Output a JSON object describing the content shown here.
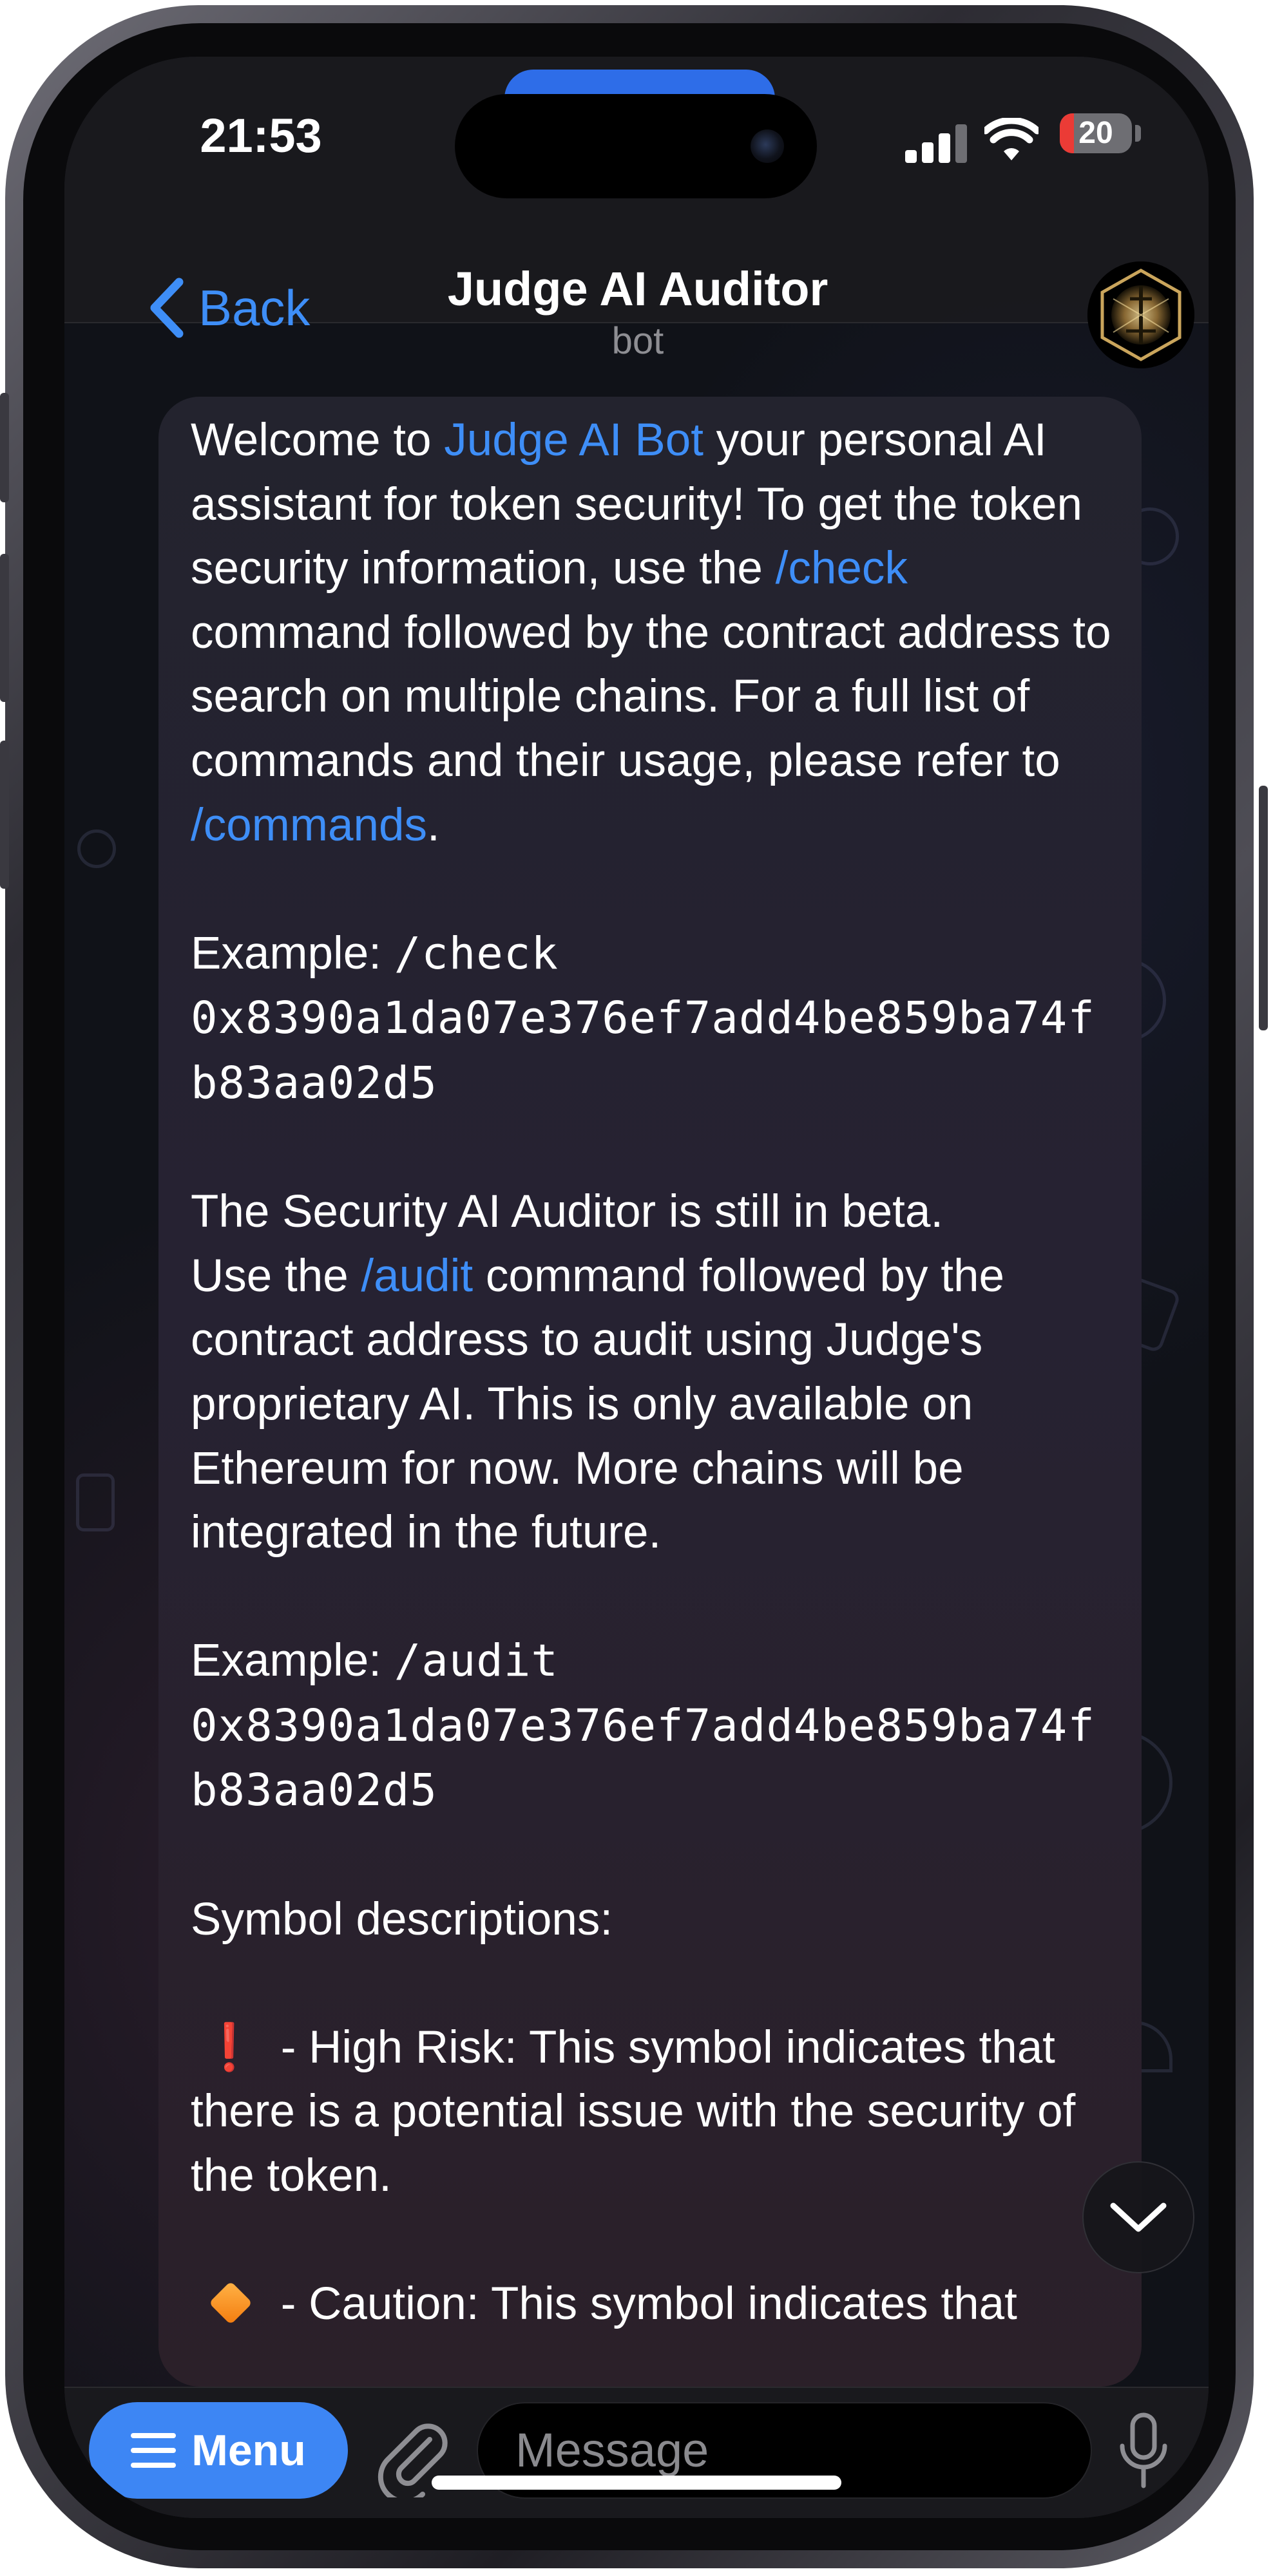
{
  "status_bar": {
    "time": "21:53",
    "battery_level": "20",
    "battery_fraction": 0.2,
    "live_activity_color": "#2e6de8"
  },
  "header": {
    "back_label": "Back",
    "title": "Judge AI Auditor",
    "subtitle": "bot",
    "avatar_icon": "judge-logo"
  },
  "message": {
    "welcome_pre": "Welcome to ",
    "welcome_link": "Judge AI Bot",
    "welcome_mid1": " your personal AI assistant for token security! To get the token security information, use the ",
    "check_link": "/check",
    "welcome_mid2": " command followed by the contract address to search on multiple chains. For a full list of commands and their usage, please refer to ",
    "commands_link": "/commands",
    "welcome_end": ".",
    "example_label": "Example: ",
    "check_example_cmd": "/check",
    "check_example_addr": "0x8390a1da07e376ef7add4be859ba74fb83aa02d5",
    "beta_line": "The Security AI Auditor is still in beta.",
    "audit_pre": "Use the ",
    "audit_link": "/audit",
    "audit_post": " command followed by the contract address to audit using Judge's proprietary AI. This is only available on Ethereum for now. More chains will be integrated in the future.",
    "audit_example_cmd": "/audit",
    "audit_example_addr": "0x8390a1da07e376ef7add4be859ba74fb83aa02d5",
    "symbols_heading": "Symbol descriptions:",
    "high_risk_symbol": "❗",
    "high_risk_text": " - High Risk: This symbol indicates that there is a potential issue with the security of the token.",
    "caution_text": " - Caution: This symbol indicates that"
  },
  "input_bar": {
    "menu_label": "Menu",
    "message_placeholder": "Message"
  },
  "colors": {
    "link": "#3e8ef7",
    "menu_button": "#3d86f4",
    "high_risk": "#e2252f",
    "caution": "#f47c0e"
  }
}
